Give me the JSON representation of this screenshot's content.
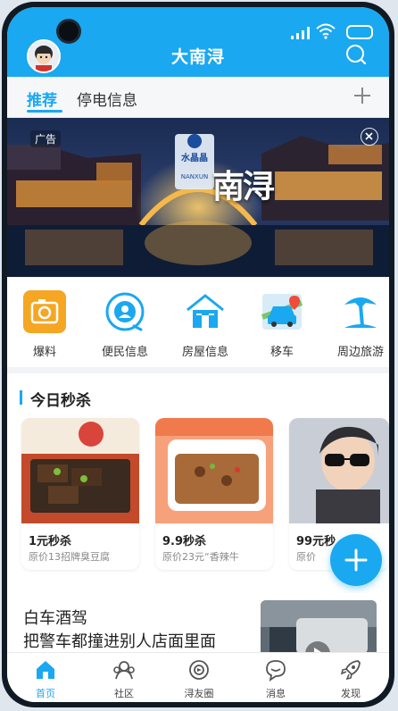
{
  "header": {
    "title": "大南浔"
  },
  "tabs": [
    {
      "label": "推荐",
      "active": true
    },
    {
      "label": "停电信息",
      "active": false
    }
  ],
  "banner": {
    "ad_label": "广告",
    "logo_text": "水晶晶",
    "logo_sub": "NANXUN",
    "headline": "南浔"
  },
  "quick_icons": [
    {
      "label": "爆料",
      "icon": "camera-icon",
      "color": "#f5a623"
    },
    {
      "label": "便民信息",
      "icon": "person-icon",
      "color": "#1aa8f0"
    },
    {
      "label": "房屋信息",
      "icon": "house-icon",
      "color": "#1aa8f0"
    },
    {
      "label": "移车",
      "icon": "car-icon",
      "color": "#1aa8f0"
    },
    {
      "label": "周边旅游",
      "icon": "palm-tree-icon",
      "color": "#1aa8f0"
    }
  ],
  "flash_sale": {
    "title": "今日秒杀",
    "items": [
      {
        "price": "1元秒杀",
        "original": "原价13招牌臭豆腐"
      },
      {
        "price": "9.9秒杀",
        "original": "原价23元“香辣牛"
      },
      {
        "price": "99元秒",
        "original": "原价"
      }
    ]
  },
  "news": {
    "line1": "白车酒驾",
    "line2": "把警车都撞进别人店面里面"
  },
  "bottom_nav": [
    {
      "label": "首页",
      "icon": "home-icon",
      "active": true
    },
    {
      "label": "社区",
      "icon": "community-icon",
      "active": false
    },
    {
      "label": "浔友圈",
      "icon": "circle-icon",
      "active": false
    },
    {
      "label": "消息",
      "icon": "message-icon",
      "active": false
    },
    {
      "label": "发现",
      "icon": "rocket-icon",
      "active": false
    }
  ],
  "colors": {
    "accent": "#1aa8f0",
    "orange": "#f5a623"
  }
}
